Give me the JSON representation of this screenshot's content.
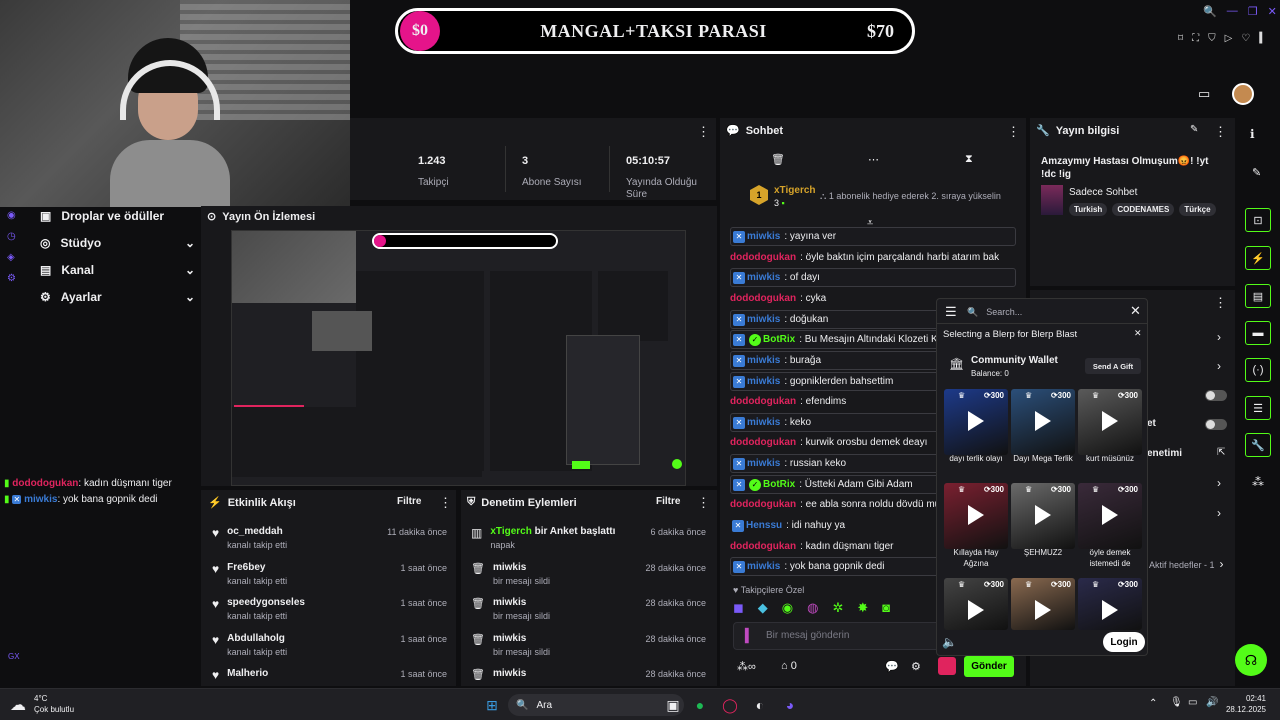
{
  "banner": {
    "current": "$0",
    "title": "MANGAL+TAKSI PARASI",
    "goal": "$70"
  },
  "stats": [
    {
      "value": "1.243",
      "label": "Takipçi"
    },
    {
      "value": "3",
      "label": "Abone Sayısı"
    },
    {
      "value": "05:10:57",
      "label": "Yayında Olduğu Süre"
    }
  ],
  "sidebar": {
    "items": [
      {
        "label": "Droplar ve ödüller"
      },
      {
        "label": "Stüdyo"
      },
      {
        "label": "Kanal"
      },
      {
        "label": "Ayarlar"
      }
    ],
    "gx": "GX"
  },
  "overlay_chat": [
    {
      "user": "dododogukan",
      "text": ": kadın düşmanı tiger"
    },
    {
      "user": "miwkis",
      "text": ": yok bana gopnik dedi"
    }
  ],
  "preview": {
    "title": "Yayın Ön İzlemesi"
  },
  "chat": {
    "title": "Sohbet",
    "gift": {
      "user": "xTigerch",
      "count": "3",
      "text": "1 abonelik hediye ederek 2. sıraya yükselin"
    },
    "messages": [
      {
        "user": "miwkis",
        "text": ": yayına ver",
        "color": "#3a7bd5"
      },
      {
        "user": "dododogukan",
        "text": ": öyle baktın içim parçalandı harbi atarım bak",
        "color": "#e0245e"
      },
      {
        "user": "miwkis",
        "text": ": of dayı",
        "color": "#3a7bd5"
      },
      {
        "user": "dododogukan",
        "text": ": cyka",
        "color": "#e0245e"
      },
      {
        "user": "miwkis",
        "text": ": doğukan",
        "color": "#3a7bd5"
      },
      {
        "user": "BotRix",
        "text": ": Bu Mesajın Altındaki Klozeti Kırdı",
        "color": "#53fc18"
      },
      {
        "user": "miwkis",
        "text": ": burağa",
        "color": "#3a7bd5"
      },
      {
        "user": "miwkis",
        "text": ": gopniklerden bahsettim",
        "color": "#3a7bd5"
      },
      {
        "user": "dododogukan",
        "text": ": efendims",
        "color": "#e0245e"
      },
      {
        "user": "miwkis",
        "text": ": keko",
        "color": "#3a7bd5"
      },
      {
        "user": "dododogukan",
        "text": ": kurwik orosbu demek deayı",
        "color": "#e0245e"
      },
      {
        "user": "miwkis",
        "text": ": russian keko",
        "color": "#3a7bd5"
      },
      {
        "user": "BotRix",
        "text": ": Üstteki Adam Gibi Adam",
        "color": "#53fc18"
      },
      {
        "user": "dododogukan",
        "text": ": ee abla sonra noldu dövdü mü sen",
        "color": "#e0245e"
      },
      {
        "user": "Henssu",
        "text": ": idi nahuy ya",
        "color": "#3a7bd5"
      },
      {
        "user": "dododogukan",
        "text": ": kadın düşmanı tiger",
        "color": "#e0245e"
      },
      {
        "user": "miwkis",
        "text": ": yok bana gopnik dedi",
        "color": "#3a7bd5"
      }
    ],
    "followers_label": "Takipçilere Özel",
    "input_placeholder": "Bir mesaj gönderin",
    "count": "0",
    "send_label": "Gönder"
  },
  "stream_info": {
    "title": "Yayın bilgisi",
    "stream_title": "Amzaymıy Hastası Olmuşum😡! !yt !dc !ig",
    "category": "Sadece Sohbet",
    "tags": [
      "Turkish",
      "CODENAMES",
      "Türkçe"
    ]
  },
  "activity": {
    "title": "Etkinlik Akışı",
    "filter": "Filtre",
    "items": [
      {
        "name": "oc_meddah",
        "sub": "kanalı takip etti",
        "time": "11 dakika önce"
      },
      {
        "name": "Fre6bey",
        "sub": "kanalı takip etti",
        "time": "1 saat önce"
      },
      {
        "name": "speedygonseles",
        "sub": "kanalı takip etti",
        "time": "1 saat önce"
      },
      {
        "name": "Abdullaholg",
        "sub": "kanalı takip etti",
        "time": "1 saat önce"
      },
      {
        "name": "Malherio",
        "sub": "",
        "time": "1 saat önce"
      }
    ]
  },
  "moderation": {
    "title": "Denetim Eylemleri",
    "filter": "Filtre",
    "items": [
      {
        "name": "xTigerch",
        "action": " bir Anket başlattı",
        "sub": "napak",
        "time": "6 dakika önce"
      },
      {
        "name": "miwkis",
        "action": "",
        "sub": "bir mesajı sildi",
        "time": "28 dakika önce"
      },
      {
        "name": "miwkis",
        "action": "",
        "sub": "bir mesajı sildi",
        "time": "28 dakika önce"
      },
      {
        "name": "miwkis",
        "action": "",
        "sub": "bir mesajı sildi",
        "time": "28 dakika önce"
      },
      {
        "name": "miwkis",
        "action": "",
        "sub": "",
        "time": "28 dakika önce"
      }
    ]
  },
  "right_panel": {
    "partial1": "et",
    "partial2": "enetimi",
    "partial3": "Aktif hedefler - 1"
  },
  "blerp": {
    "search_placeholder": "Search...",
    "title": "Selecting a Blerp for Blerp Blast",
    "wallet_title": "Community Wallet",
    "balance": "Balance: 0",
    "gift_label": "Send A Gift",
    "tiles": [
      {
        "label": "dayı terlik olayı",
        "count": "300",
        "color": "#1d3a8a"
      },
      {
        "label": "Dayı Mega Terlik",
        "count": "300",
        "color": "#2b4f7a"
      },
      {
        "label": "kurt müsünüz",
        "count": "300",
        "color": "#5a5a5a"
      },
      {
        "label": "Kıllayda Hay Ağzına",
        "count": "300",
        "color": "#7a2030"
      },
      {
        "label": "ŞEHMUZ2",
        "count": "300",
        "color": "#6a6a6a"
      },
      {
        "label": "öyle demek istemedi de",
        "count": "300",
        "color": "#3a2a3a"
      },
      {
        "label": "",
        "count": "300",
        "color": "#444"
      },
      {
        "label": "",
        "count": "300",
        "color": "#8a6a50"
      },
      {
        "label": "",
        "count": "300",
        "color": "#2a2a4a"
      }
    ],
    "login_label": "Login"
  },
  "taskbar": {
    "weather_temp": "4°C",
    "weather_desc": "Çok bulutlu",
    "search_label": "Ara",
    "time": "02:41",
    "date": "28.12.2025"
  },
  "colors": {
    "accent": "#53fc18",
    "bg": "#0e0e10",
    "panel": "#18181b",
    "pink": "#e5148a"
  }
}
